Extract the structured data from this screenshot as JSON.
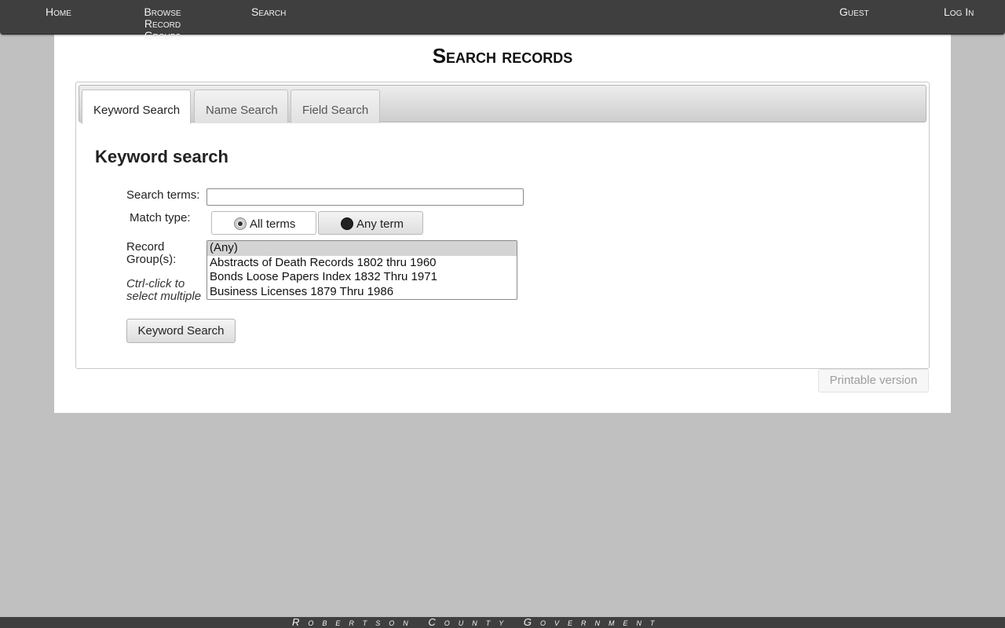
{
  "nav": {
    "home": "Home",
    "browse_line1": "Browse Record",
    "browse_line2": "Groups",
    "search": "Search",
    "guest": "Guest",
    "login": "Log In"
  },
  "page": {
    "title": "Search records"
  },
  "tabs": [
    {
      "label": "Keyword Search",
      "active": true
    },
    {
      "label": "Name Search",
      "active": false
    },
    {
      "label": "Field Search",
      "active": false
    }
  ],
  "form": {
    "section_title": "Keyword search",
    "search_terms_label": "Search terms:",
    "search_terms_value": "",
    "match_type_label": "Match type:",
    "match_options": [
      {
        "label": "All terms",
        "checked": true
      },
      {
        "label": "Any term",
        "checked": false
      }
    ],
    "record_group_label": "Record Group(s):",
    "record_group_hint": "Ctrl-click to select multiple",
    "record_groups": [
      {
        "label": "(Any)",
        "selected": true
      },
      {
        "label": "Abstracts of Death Records 1802 thru 1960",
        "selected": false
      },
      {
        "label": "Bonds Loose Papers Index 1832 Thru 1971",
        "selected": false
      },
      {
        "label": "Business Licenses 1879 Thru 1986",
        "selected": false
      }
    ],
    "submit_label": "Keyword Search"
  },
  "printable_label": "Printable version",
  "footer": {
    "text": "Robertson County Government"
  },
  "colors": {
    "nav_bg": "#3f3f3f",
    "page_bg": "#c0c0c0",
    "panel_bg": "#ffffff",
    "selected_option_bg": "#d4d4d4"
  }
}
